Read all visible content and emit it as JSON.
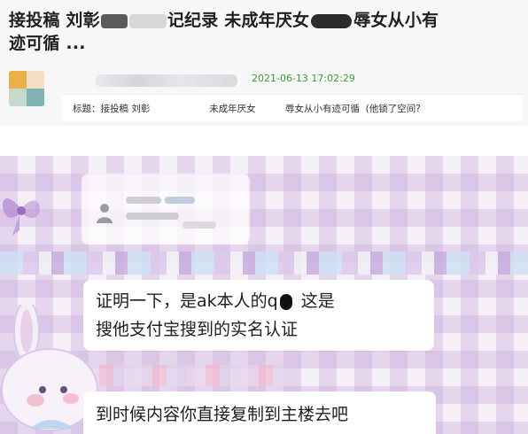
{
  "post": {
    "title_part1": "接投稿 刘彰",
    "title_part2": "记纪录 未成年厌女",
    "title_part3": "辱女从小有",
    "title_line2": "迹可循 ...",
    "timestamp": "2021-06-13 17:02:29",
    "subject_part1": "标题：接投稿 刘彰",
    "subject_part2": "未成年厌女",
    "subject_part3": "辱女从小有迹可循  (他锁了空间?"
  },
  "chat": {
    "message1_line1_a": "证明一下，是ak本人的q",
    "message1_line1_b": "这是",
    "message1_line2": "搜他支付宝搜到的实名认证",
    "message2": "到时候内容你直接复制到主楼去吧"
  },
  "colors": {
    "timestamp_green": "#3a9a3a",
    "gingham_purple": "#c9a8db",
    "bubble_bg": "#ffffff",
    "page_bg": "#f7f7f8"
  }
}
